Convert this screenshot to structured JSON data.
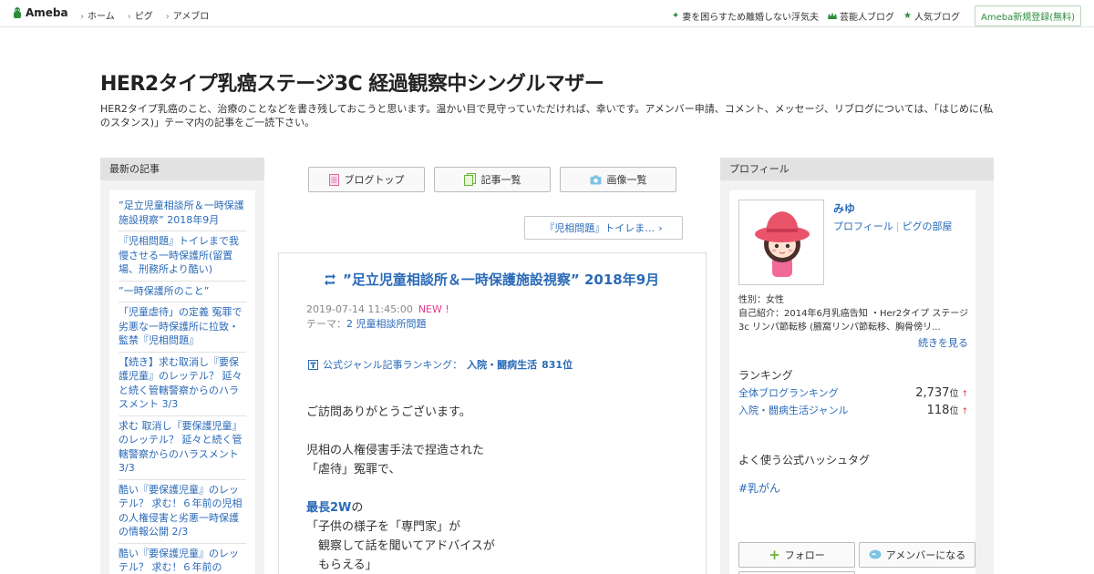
{
  "global_header": {
    "logo": "Ameba",
    "nav": [
      "ホーム",
      "ピグ",
      "アメブロ"
    ],
    "right_links": [
      {
        "label": "妻を困らすため離婚しない浮気夫",
        "icon": "sparkle-icon"
      },
      {
        "label": "芸能人ブログ",
        "icon": "crown-icon"
      },
      {
        "label": "人気ブログ",
        "icon": "star-icon"
      }
    ],
    "register": "Ameba新規登録(無料)"
  },
  "blog": {
    "title": "HER2タイプ乳癌ステージ3C 経過観察中シングルマザー",
    "description": "HER2タイプ乳癌のこと、治療のことなどを書き残しておこうと思います。温かい目で見守っていただければ、幸いです。アメンバー申請、コメント、メッセージ、リブログについては、「はじめに(私のスタンス)」テーマ内の記事をご一読下さい。"
  },
  "left": {
    "heading": "最新の記事",
    "items": [
      "”足立児童相談所＆一時保護施設視察” 2018年9月",
      "『児相問題』トイレまで我慢させる一時保護所(留置場、刑務所より酷い)",
      "”一時保護所のこと”",
      "「児童虐待」の定義 冤罪で劣悪な一時保護所に拉致・監禁『児相問題』",
      "【続き】求む取消し『要保護児童』のレッテル？ 延々と続く管轄警察からのハラスメント 3/3",
      "求む 取消し『要保護児童』のレッテル？ 延々と続く管轄警察からのハラスメント 3/3",
      "酷い『要保護児童』のレッテル？ 求む！６年前の児相の人権侵害と劣悪一時保護の情報公開 2/3",
      "酷い『要保護児童』のレッテル？ 求む！６年前の"
    ]
  },
  "center": {
    "tabs": [
      {
        "label": "ブログトップ",
        "icon": "blog-top-icon"
      },
      {
        "label": "記事一覧",
        "icon": "article-list-icon"
      },
      {
        "label": "画像一覧",
        "icon": "camera-icon"
      }
    ],
    "next_link": "『児相問題』トイレま…",
    "article": {
      "title": "”足立児童相談所＆一時保護施設視察” 2018年9月",
      "date": "2019-07-14 11:45:00",
      "new_badge": "NEW !",
      "theme_label": "テーマ：",
      "theme": "2 児童相談所問題",
      "ranking_label": "公式ジャンル記事ランキング：",
      "ranking_genre": "入院・闘病生活",
      "ranking_value": "831位",
      "body": {
        "line1": "ご訪問ありがとうございます。",
        "line2": "児相の人権侵害手法で捏造された",
        "line3": "「虐待」冤罪で、",
        "strong": "最長2W",
        "line4_rest": "の",
        "line5": "「子供の様子を「専門家」が",
        "line6": "　観察して話を聞いてアドバイスが",
        "line7": "　もらえる」"
      }
    }
  },
  "right": {
    "heading": "プロフィール",
    "name": "みゆ",
    "link_profile": "プロフィール",
    "link_pigg": "ピグの部屋",
    "gender": "性別：女性",
    "intro": "自己紹介：2014年6月乳癌告知 ・Her2タイプ ステージ3c リンパ節転移 (腋窩リンパ節転移、胸骨傍リ...",
    "more": "続きを見る",
    "ranking_heading": "ランキング",
    "rankings": [
      {
        "name": "全体ブログランキング",
        "value": "2,737",
        "unit": "位",
        "trend": "↑"
      },
      {
        "name": "入院・闘病生活ジャンル",
        "value": "118",
        "unit": "位",
        "trend": "↑"
      }
    ],
    "hashtag_heading": "よく使う公式ハッシュタグ",
    "hashtag": "#乳がん",
    "follow": "フォロー",
    "amember": "アメンバーになる"
  },
  "colors": {
    "link": "#2a6ab8",
    "ameba_green": "#2d8c3c",
    "new_pink": "#e23a8a"
  }
}
